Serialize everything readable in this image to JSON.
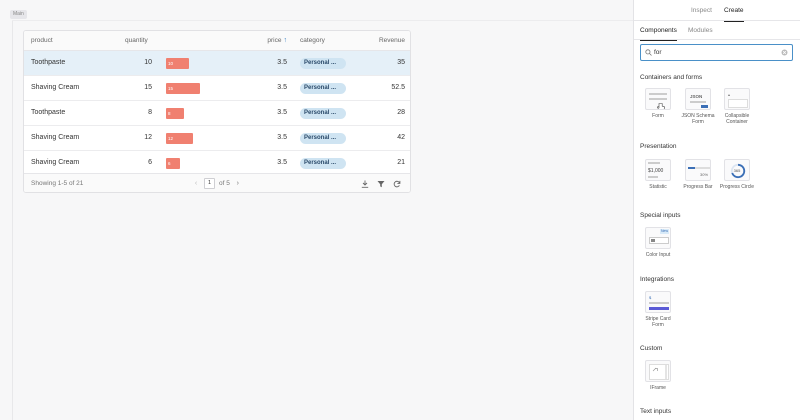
{
  "canvas": {
    "tag": "Main"
  },
  "table": {
    "headers": {
      "product": "product",
      "quantity": "quantity",
      "price": "price",
      "category": "category",
      "revenue": "Revenue"
    },
    "rows": [
      {
        "product": "Toothpaste",
        "quantity": "10",
        "bar_label": "10",
        "bar_value": 10,
        "price": "3.5",
        "category": "Personal ...",
        "revenue": "35"
      },
      {
        "product": "Shaving Cream",
        "quantity": "15",
        "bar_label": "15",
        "bar_value": 15,
        "price": "3.5",
        "category": "Personal ...",
        "revenue": "52.5"
      },
      {
        "product": "Toothpaste",
        "quantity": "8",
        "bar_label": "8",
        "bar_value": 8,
        "price": "3.5",
        "category": "Personal ...",
        "revenue": "28"
      },
      {
        "product": "Shaving Cream",
        "quantity": "12",
        "bar_label": "12",
        "bar_value": 12,
        "price": "3.5",
        "category": "Personal ...",
        "revenue": "42"
      },
      {
        "product": "Shaving Cream",
        "quantity": "6",
        "bar_label": "6",
        "bar_value": 6,
        "price": "3.5",
        "category": "Personal ...",
        "revenue": "21"
      }
    ],
    "selected_row": 0,
    "footer": {
      "showing": "Showing 1-5 of 21",
      "page": "1",
      "of_pages": "of 5"
    },
    "colors": {
      "bar": "#f08070",
      "pill": "#cfe4f2",
      "selected": "#e5f0f8"
    }
  },
  "panel": {
    "tabs": {
      "inspect": "Inspect",
      "create": "Create"
    },
    "subtabs": {
      "components": "Components",
      "modules": "Modules"
    },
    "search": {
      "value": "for",
      "placeholder": ""
    },
    "sections": {
      "containers": "Containers and forms",
      "presentation": "Presentation",
      "special": "Special inputs",
      "integrations": "Integrations",
      "custom": "Custom",
      "text": "Text inputs"
    },
    "components": {
      "form": "Form",
      "json_schema_form": "JSON Schema Form",
      "collapsible_container": "Collapsible Container",
      "statistic": "Statistic",
      "progress_bar": "Progress Bar",
      "progress_circle": "Progress Circle",
      "color_input": "Color Input",
      "stripe_card_form": "Stripe Card Form",
      "iframe": "IFrame"
    },
    "thumb_text": {
      "json": "JSON",
      "statistic": "$1,000",
      "progress_bar": "30%",
      "progress_circle": "365",
      "color_input_badge": "New"
    }
  }
}
